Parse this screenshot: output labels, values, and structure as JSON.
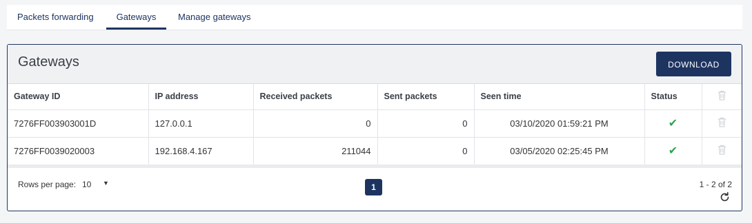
{
  "tabs": [
    {
      "label": "Packets forwarding",
      "active": false
    },
    {
      "label": "Gateways",
      "active": true
    },
    {
      "label": "Manage gateways",
      "active": false
    }
  ],
  "panel": {
    "title": "Gateways",
    "download_label": "DOWNLOAD"
  },
  "table": {
    "columns": [
      "Gateway ID",
      "IP address",
      "Received packets",
      "Sent packets",
      "Seen time",
      "Status"
    ],
    "rows": [
      {
        "gateway_id": "7276FF003903001D",
        "ip": "127.0.0.1",
        "received": "0",
        "sent": "0",
        "seen": "03/10/2020 01:59:21 PM",
        "status": "ok"
      },
      {
        "gateway_id": "7276FF0039020003",
        "ip": "192.168.4.167",
        "received": "211044",
        "sent": "0",
        "seen": "03/05/2020 02:25:45 PM",
        "status": "ok"
      }
    ]
  },
  "pagination": {
    "rows_per_page_label": "Rows per page:",
    "rows_per_page_value": "10",
    "current_page": "1",
    "range_text": "1 - 2 of 2"
  },
  "icons": {
    "status_ok": "check-icon",
    "delete": "trash-icon",
    "refresh": "refresh-icon",
    "dropdown": "caret-down-icon"
  },
  "colors": {
    "primary": "#1d3461",
    "success": "#2ea44f",
    "disabled_icon": "#d0d3d8"
  }
}
